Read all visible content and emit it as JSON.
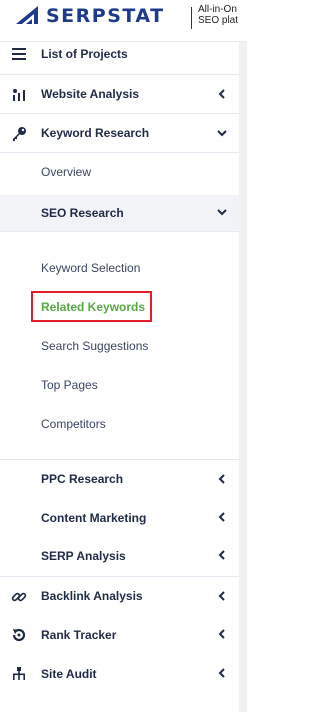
{
  "header": {
    "brand": "SERPSTAT",
    "tagline_line1": "All-in-On",
    "tagline_line2": "SEO plat"
  },
  "nav": {
    "list_of_projects": "List of Projects",
    "website_analysis": "Website Analysis",
    "keyword_research": "Keyword Research",
    "overview": "Overview",
    "seo_research": "SEO Research",
    "keyword_selection": "Keyword Selection",
    "related_keywords": "Related Keywords",
    "search_suggestions": "Search Suggestions",
    "top_pages": "Top Pages",
    "competitors": "Competitors",
    "ppc_research": "PPC Research",
    "content_marketing": "Content Marketing",
    "serp_analysis": "SERP Analysis",
    "backlink_analysis": "Backlink Analysis",
    "rank_tracker": "Rank Tracker",
    "site_audit": "Site Audit"
  },
  "colors": {
    "brand": "#1f3a8a",
    "active_item": "#57a845",
    "highlight_box": "#e11d2a"
  }
}
